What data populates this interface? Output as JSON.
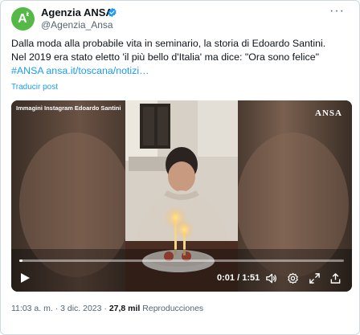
{
  "account": {
    "name": "Agenzia ANSA",
    "handle": "@Agenzia_Ansa",
    "avatar_text": "A",
    "avatar_sup": "it",
    "more_label": "···"
  },
  "post": {
    "line1": "Dalla moda alla probabile vita in seminario, la storia di Edoardo Santini.",
    "line2": "Nel 2019 era stato eletto 'il più bello d'Italia' ma dice: \"Ora sono felice\"",
    "hashtag": "#ANSA",
    "url": "ansa.it/toscana/notizi…",
    "translate": "Traducir post"
  },
  "video": {
    "caption": "Immagini Instagram Edoardo Santini",
    "logo": "ANSA",
    "elapsed": "0:01",
    "duration": "1:51",
    "progress_fraction": 0.01
  },
  "meta": {
    "time": "11:03 a. m.",
    "sep": "·",
    "date": "3 dic. 2023",
    "views": "27,8 mil",
    "views_label": "Reproducciones"
  },
  "colors": {
    "accent": "#1d9bf0",
    "avatar": "#55b948",
    "muted": "#536471"
  },
  "icons": [
    "verified-badge-icon",
    "play-icon",
    "volume-icon",
    "settings-icon",
    "fullscreen-icon",
    "share-icon",
    "more-icon"
  ]
}
